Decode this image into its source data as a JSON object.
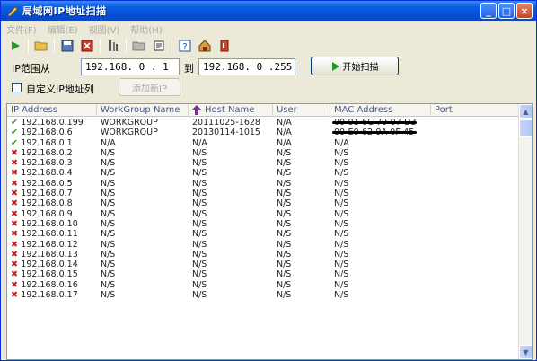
{
  "window": {
    "title": "局域网IP地址扫描"
  },
  "menu": [
    "文件(F)",
    "编辑(E)",
    "视图(V)",
    "帮助(H)"
  ],
  "toolbar_icons": [
    "play-icon",
    "open-folder-icon",
    "save-icon",
    "delete-icon",
    "filter-icon",
    "folder-icon",
    "export-icon",
    "help-icon",
    "home-icon",
    "exit-icon"
  ],
  "scan": {
    "ip_range_label": "IP范围从",
    "from_ip": "192.168. 0 . 1",
    "to_label": "到",
    "to_ip": "192.168. 0 .255",
    "start_label": "开始扫描",
    "custom_label": "自定义IP地址列",
    "add_new_label": "添加新IP"
  },
  "columns": [
    "IP Address",
    "WorkGroup Name",
    "Host Name",
    "User",
    "MAC Address",
    "Port"
  ],
  "rows": [
    {
      "status": "ok",
      "ip": "192.168.0.199",
      "wg": "WORKGROUP",
      "host": "20111025-1628",
      "user": "N/A",
      "mac": "00-01-6C-79-07-D3",
      "port": ""
    },
    {
      "status": "ok",
      "ip": "192.168.0.6",
      "wg": "WORKGROUP",
      "host": "20130114-1015",
      "user": "N/A",
      "mac": "00-E0-62-9A-0F-45",
      "port": ""
    },
    {
      "status": "ok",
      "ip": "192.168.0.1",
      "wg": "N/A",
      "host": "N/A",
      "user": "N/A",
      "mac": "N/A",
      "port": ""
    },
    {
      "status": "x",
      "ip": "192.168.0.2",
      "wg": "N/S",
      "host": "N/S",
      "user": "N/S",
      "mac": "N/S",
      "port": ""
    },
    {
      "status": "x",
      "ip": "192.168.0.3",
      "wg": "N/S",
      "host": "N/S",
      "user": "N/S",
      "mac": "N/S",
      "port": ""
    },
    {
      "status": "x",
      "ip": "192.168.0.4",
      "wg": "N/S",
      "host": "N/S",
      "user": "N/S",
      "mac": "N/S",
      "port": ""
    },
    {
      "status": "x",
      "ip": "192.168.0.5",
      "wg": "N/S",
      "host": "N/S",
      "user": "N/S",
      "mac": "N/S",
      "port": ""
    },
    {
      "status": "x",
      "ip": "192.168.0.7",
      "wg": "N/S",
      "host": "N/S",
      "user": "N/S",
      "mac": "N/S",
      "port": ""
    },
    {
      "status": "x",
      "ip": "192.168.0.8",
      "wg": "N/S",
      "host": "N/S",
      "user": "N/S",
      "mac": "N/S",
      "port": ""
    },
    {
      "status": "x",
      "ip": "192.168.0.9",
      "wg": "N/S",
      "host": "N/S",
      "user": "N/S",
      "mac": "N/S",
      "port": ""
    },
    {
      "status": "x",
      "ip": "192.168.0.10",
      "wg": "N/S",
      "host": "N/S",
      "user": "N/S",
      "mac": "N/S",
      "port": ""
    },
    {
      "status": "x",
      "ip": "192.168.0.11",
      "wg": "N/S",
      "host": "N/S",
      "user": "N/S",
      "mac": "N/S",
      "port": ""
    },
    {
      "status": "x",
      "ip": "192.168.0.12",
      "wg": "N/S",
      "host": "N/S",
      "user": "N/S",
      "mac": "N/S",
      "port": ""
    },
    {
      "status": "x",
      "ip": "192.168.0.13",
      "wg": "N/S",
      "host": "N/S",
      "user": "N/S",
      "mac": "N/S",
      "port": ""
    },
    {
      "status": "x",
      "ip": "192.168.0.14",
      "wg": "N/S",
      "host": "N/S",
      "user": "N/S",
      "mac": "N/S",
      "port": ""
    },
    {
      "status": "x",
      "ip": "192.168.0.15",
      "wg": "N/S",
      "host": "N/S",
      "user": "N/S",
      "mac": "N/S",
      "port": ""
    },
    {
      "status": "x",
      "ip": "192.168.0.16",
      "wg": "N/S",
      "host": "N/S",
      "user": "N/S",
      "mac": "N/S",
      "port": ""
    },
    {
      "status": "x",
      "ip": "192.168.0.17",
      "wg": "N/S",
      "host": "N/S",
      "user": "N/S",
      "mac": "N/S",
      "port": ""
    }
  ],
  "colors": {
    "title_bar": "#0551d6",
    "ok": "#3a8a2a",
    "fail": "#c02020"
  }
}
